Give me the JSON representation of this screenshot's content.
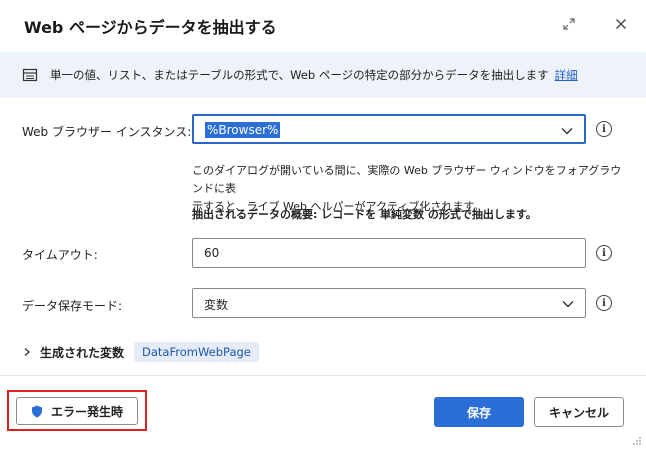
{
  "dialog": {
    "title": "Web ページからデータを抽出する",
    "expand_icon": "expand-icon",
    "close_icon": "close-icon"
  },
  "banner": {
    "icon": "list-icon",
    "text": "単一の値、リスト、またはテーブルの形式で、Web ページの特定の部分からデータを抽出します",
    "link": "詳細"
  },
  "browser_instance": {
    "label": "Web ブラウザー インスタンス:",
    "value": "%Browser%",
    "info_glyph": "i"
  },
  "help_text": {
    "line1": "このダイアログが開いている間に、実際の Web ブラウザー ウィンドウをフォアグラウンドに表",
    "line2": "示すると、ライブ Web ヘルパーがアクティブ化されます。",
    "summary": "抽出されるデータの概要: レコードを 単純変数 の形式で抽出します。"
  },
  "timeout": {
    "label": "タイムアウト:",
    "value": "60",
    "info_glyph": "i"
  },
  "storage_mode": {
    "label": "データ保存モード:",
    "value": "変数",
    "info_glyph": "i"
  },
  "variables": {
    "label": "生成された変数",
    "badge": "DataFromWebPage"
  },
  "footer": {
    "error_button": "エラー発生時",
    "save_button": "保存",
    "cancel_button": "キャンセル"
  },
  "colors": {
    "accent": "#2b6fd6",
    "highlight": "#e0201e",
    "banner_bg": "#eef2f9"
  }
}
